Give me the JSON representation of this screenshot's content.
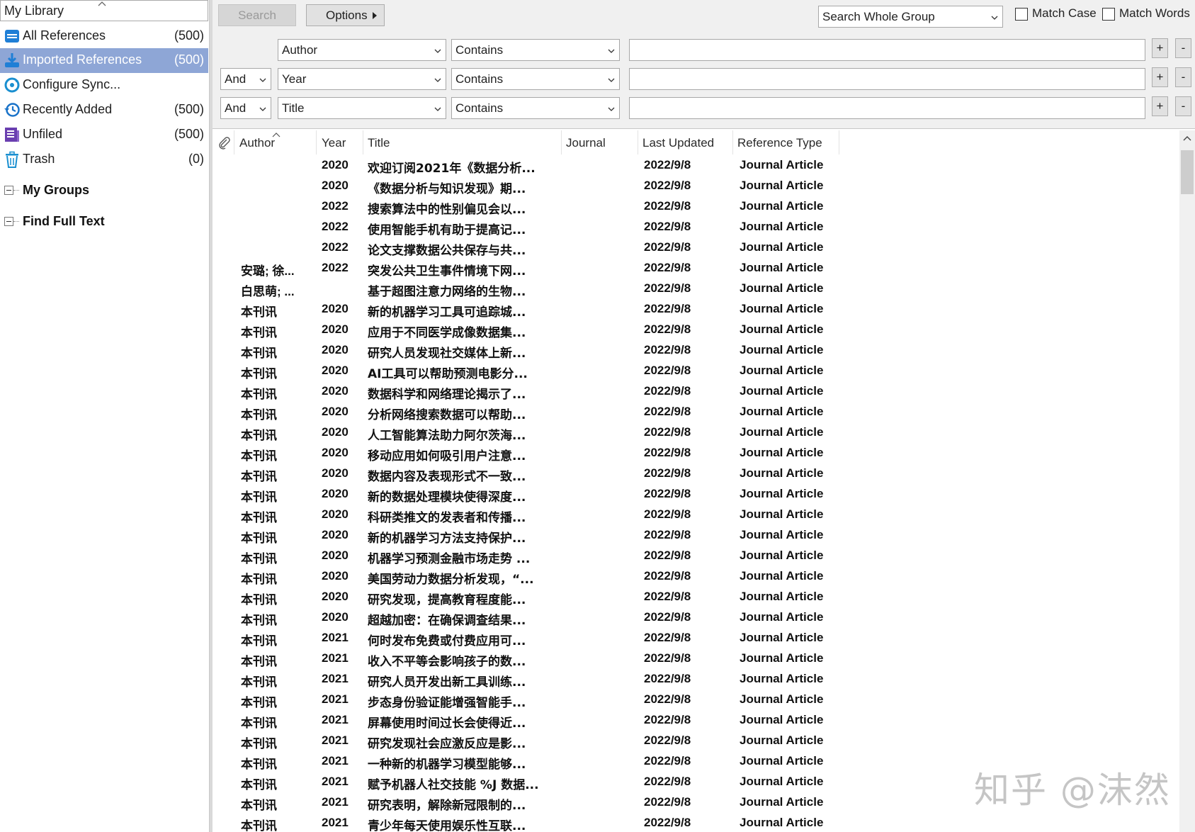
{
  "sidebar": {
    "library_title": "My Library",
    "groups": [
      {
        "label": "All References",
        "count": "(500)",
        "icon": "all-references-icon"
      },
      {
        "label": "Imported References",
        "count": "(500)",
        "icon": "imported-references-icon"
      },
      {
        "label": "Configure Sync...",
        "count": "",
        "icon": "sync-icon"
      },
      {
        "label": "Recently Added",
        "count": "(500)",
        "icon": "recently-added-icon"
      },
      {
        "label": "Unfiled",
        "count": "(500)",
        "icon": "unfiled-icon"
      },
      {
        "label": "Trash",
        "count": "(0)",
        "icon": "trash-icon"
      }
    ],
    "sections": [
      "My Groups",
      "Find Full Text"
    ],
    "selected_color": "#8ea6d6"
  },
  "search": {
    "search_label": "Search",
    "options_label": "Options",
    "scope": "Search Whole Group",
    "match_case": "Match Case",
    "match_words": "Match Words",
    "rows": [
      {
        "bool": "",
        "field": "Author",
        "op": "Contains",
        "value": ""
      },
      {
        "bool": "And",
        "field": "Year",
        "op": "Contains",
        "value": ""
      },
      {
        "bool": "And",
        "field": "Title",
        "op": "Contains",
        "value": ""
      }
    ],
    "plus": "+",
    "minus": "-"
  },
  "list": {
    "columns": [
      "Author",
      "Year",
      "Title",
      "Journal",
      "Last Updated",
      "Reference Type"
    ],
    "rows": [
      {
        "author": "",
        "year": "2020",
        "title": "欢迎订阅2021年《数据分析...",
        "updated": "2022/9/8",
        "type": "Journal Article"
      },
      {
        "author": "",
        "year": "2020",
        "title": "《数据分析与知识发现》期...",
        "updated": "2022/9/8",
        "type": "Journal Article"
      },
      {
        "author": "",
        "year": "2022",
        "title": "搜索算法中的性别偏见会以...",
        "updated": "2022/9/8",
        "type": "Journal Article"
      },
      {
        "author": "",
        "year": "2022",
        "title": "使用智能手机有助于提高记...",
        "updated": "2022/9/8",
        "type": "Journal Article"
      },
      {
        "author": "",
        "year": "2022",
        "title": "论文支撑数据公共保存与共...",
        "updated": "2022/9/8",
        "type": "Journal Article"
      },
      {
        "author": "安璐; 徐...",
        "year": "2022",
        "title": "突发公共卫生事件情境下网...",
        "updated": "2022/9/8",
        "type": "Journal Article"
      },
      {
        "author": "白思萌; ...",
        "year": "",
        "title": "基于超图注意力网络的生物...",
        "updated": "2022/9/8",
        "type": "Journal Article"
      },
      {
        "author": "本刊讯",
        "year": "2020",
        "title": "新的机器学习工具可追踪城...",
        "updated": "2022/9/8",
        "type": "Journal Article"
      },
      {
        "author": "本刊讯",
        "year": "2020",
        "title": "应用于不同医学成像数据集...",
        "updated": "2022/9/8",
        "type": "Journal Article"
      },
      {
        "author": "本刊讯",
        "year": "2020",
        "title": "研究人员发现社交媒体上新...",
        "updated": "2022/9/8",
        "type": "Journal Article"
      },
      {
        "author": "本刊讯",
        "year": "2020",
        "title": "AI工具可以帮助预测电影分...",
        "updated": "2022/9/8",
        "type": "Journal Article"
      },
      {
        "author": "本刊讯",
        "year": "2020",
        "title": "数据科学和网络理论揭示了...",
        "updated": "2022/9/8",
        "type": "Journal Article"
      },
      {
        "author": "本刊讯",
        "year": "2020",
        "title": "分析网络搜索数据可以帮助...",
        "updated": "2022/9/8",
        "type": "Journal Article"
      },
      {
        "author": "本刊讯",
        "year": "2020",
        "title": "人工智能算法助力阿尔茨海...",
        "updated": "2022/9/8",
        "type": "Journal Article"
      },
      {
        "author": "本刊讯",
        "year": "2020",
        "title": "移动应用如何吸引用户注意...",
        "updated": "2022/9/8",
        "type": "Journal Article"
      },
      {
        "author": "本刊讯",
        "year": "2020",
        "title": "数据内容及表现形式不一致...",
        "updated": "2022/9/8",
        "type": "Journal Article"
      },
      {
        "author": "本刊讯",
        "year": "2020",
        "title": "新的数据处理模块使得深度...",
        "updated": "2022/9/8",
        "type": "Journal Article"
      },
      {
        "author": "本刊讯",
        "year": "2020",
        "title": "科研类推文的发表者和传播...",
        "updated": "2022/9/8",
        "type": "Journal Article"
      },
      {
        "author": "本刊讯",
        "year": "2020",
        "title": "新的机器学习方法支持保护...",
        "updated": "2022/9/8",
        "type": "Journal Article"
      },
      {
        "author": "本刊讯",
        "year": "2020",
        "title": "机器学习预测金融市场走势 ...",
        "updated": "2022/9/8",
        "type": "Journal Article"
      },
      {
        "author": "本刊讯",
        "year": "2020",
        "title": "美国劳动力数据分析发现，“...",
        "updated": "2022/9/8",
        "type": "Journal Article"
      },
      {
        "author": "本刊讯",
        "year": "2020",
        "title": "研究发现，提高教育程度能...",
        "updated": "2022/9/8",
        "type": "Journal Article"
      },
      {
        "author": "本刊讯",
        "year": "2020",
        "title": "超越加密：在确保调查结果...",
        "updated": "2022/9/8",
        "type": "Journal Article"
      },
      {
        "author": "本刊讯",
        "year": "2021",
        "title": "何时发布免费或付费应用可...",
        "updated": "2022/9/8",
        "type": "Journal Article"
      },
      {
        "author": "本刊讯",
        "year": "2021",
        "title": "收入不平等会影响孩子的数...",
        "updated": "2022/9/8",
        "type": "Journal Article"
      },
      {
        "author": "本刊讯",
        "year": "2021",
        "title": "研究人员开发出新工具训练...",
        "updated": "2022/9/8",
        "type": "Journal Article"
      },
      {
        "author": "本刊讯",
        "year": "2021",
        "title": "步态身份验证能增强智能手...",
        "updated": "2022/9/8",
        "type": "Journal Article"
      },
      {
        "author": "本刊讯",
        "year": "2021",
        "title": "屏幕使用时间过长会使得近...",
        "updated": "2022/9/8",
        "type": "Journal Article"
      },
      {
        "author": "本刊讯",
        "year": "2021",
        "title": "研究发现社会应激反应是影...",
        "updated": "2022/9/8",
        "type": "Journal Article"
      },
      {
        "author": "本刊讯",
        "year": "2021",
        "title": "一种新的机器学习模型能够...",
        "updated": "2022/9/8",
        "type": "Journal Article"
      },
      {
        "author": "本刊讯",
        "year": "2021",
        "title": "赋予机器人社交技能 %J 数据...",
        "updated": "2022/9/8",
        "type": "Journal Article"
      },
      {
        "author": "本刊讯",
        "year": "2021",
        "title": "研究表明，解除新冠限制的...",
        "updated": "2022/9/8",
        "type": "Journal Article"
      },
      {
        "author": "本刊讯",
        "year": "2021",
        "title": "青少年每天使用娱乐性互联...",
        "updated": "2022/9/8",
        "type": "Journal Article"
      }
    ]
  },
  "watermark": "知乎 @沫然"
}
